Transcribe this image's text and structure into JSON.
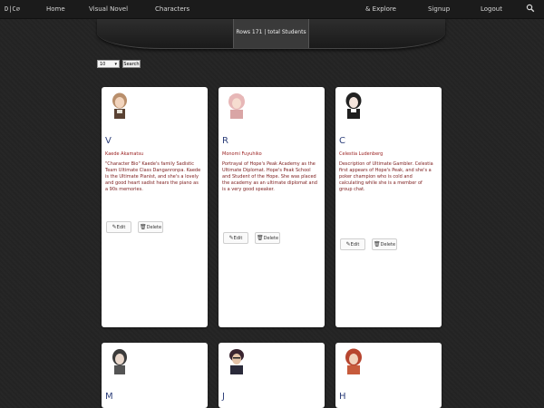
{
  "nav": {
    "brand": "D|C∅",
    "home": "Home",
    "visual_novel": "Visual Novel",
    "characters": "Characters",
    "explore": "& Explore",
    "signup": "Signup",
    "logout": "Logout"
  },
  "banner": {
    "title": "Rows 171 | total Students"
  },
  "controls": {
    "selected": "10",
    "search_label": "Search"
  },
  "cards": [
    {
      "initial": "V",
      "name": "Kaede Akamatsu",
      "description": "\"Character Bio\" Kaede's family Sadistic Team Ultimate Class Danganronpa. Kaede is the Ultimate Pianist, and she's a lovely and good heart sadist hears the piano as a 90s memories.",
      "edit": "Edit",
      "delete": "Delete"
    },
    {
      "initial": "R",
      "name": "Monomi Fuyuhiko",
      "description": "Portrayal of Hope's Peak Academy as the Ultimate Diplomat. Hope's Peak School and Student of the Hope. She was placed the academy as an ultimate diplomat and is a very good speaker.",
      "edit": "Edit",
      "delete": "Delete"
    },
    {
      "initial": "C",
      "name": "Celestia Ludenberg",
      "description": "Description of Ultimate Gambler. Celestia first appears of Hope's Peak, and she's a poker champion who is cold and calculating while she is a member of group chat.",
      "edit": "Edit",
      "delete": "Delete"
    },
    {
      "initial": "M"
    },
    {
      "initial": "J"
    },
    {
      "initial": "H"
    }
  ],
  "colors": {
    "background": "#242424",
    "card": "#ffffff",
    "name": "#9a2020",
    "initial": "#2d3f7a"
  }
}
